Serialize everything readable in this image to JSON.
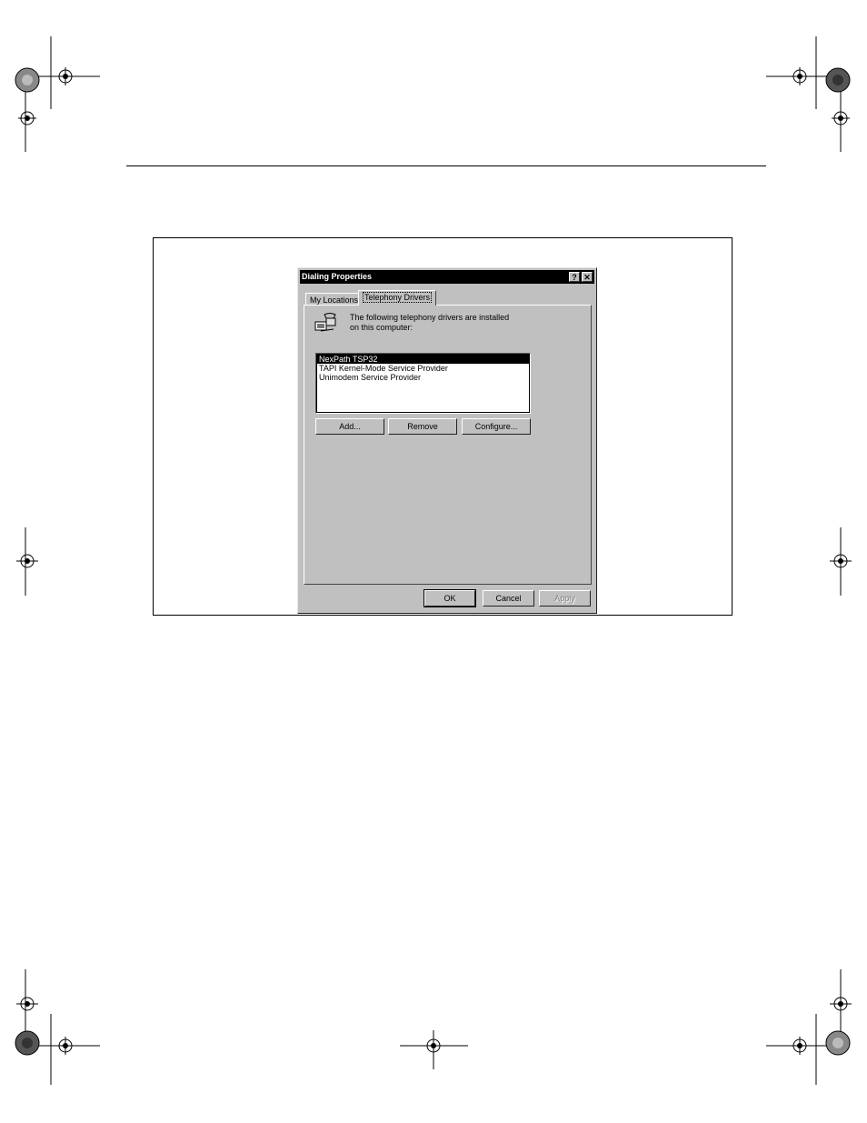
{
  "dialog": {
    "title": "Dialing Properties",
    "help_glyph": "?",
    "close_glyph": "✕",
    "tabs": [
      {
        "label": "My Locations"
      },
      {
        "label": "Telephony Drivers"
      }
    ],
    "description_line1": "The following telephony drivers are installed",
    "description_line2": "on this computer:",
    "drivers": [
      "NexPath TSP32",
      "TAPI Kernel-Mode Service Provider",
      "Unimodem Service Provider"
    ],
    "selected_driver_index": 0,
    "buttons": {
      "add": "Add...",
      "remove": "Remove",
      "configure": "Configure...",
      "ok": "OK",
      "cancel": "Cancel",
      "apply": "Apply"
    }
  },
  "icons": [
    "telephony-drivers-icon",
    "registration-mark-icon",
    "color-wheel-icon"
  ]
}
